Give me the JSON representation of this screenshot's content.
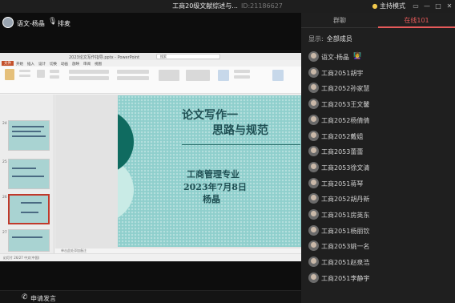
{
  "window": {
    "title": "工商20级文献综述与...",
    "room_id": "ID:21186627",
    "mode_label": "主持模式"
  },
  "stage": {
    "host_name": "语文-杨晶",
    "pin_label": "排麦"
  },
  "ppt": {
    "file_name": "2023论文写作指导.pptx - PowerPoint",
    "search_placeholder": "搜索",
    "tabs": [
      "文件",
      "开始",
      "插入",
      "设计",
      "切换",
      "动画",
      "放映",
      "审阅",
      "视图"
    ],
    "slide_numbers": [
      "24",
      "25",
      "26",
      "27"
    ],
    "notes_placeholder": "单击此处添加备注",
    "status_text": "幻灯片 26/27  中文(中国)",
    "slide": {
      "title_line1": "论文写作一",
      "title_line2": "思路与规范",
      "sub1": "工商管理专业",
      "sub2": "2023年7月8日",
      "sub3": "杨晶"
    }
  },
  "bottom": {
    "handraise_label": "申请发言"
  },
  "side": {
    "tab_chat": "群聊",
    "tab_online": "在线101",
    "filter_label": "显示:",
    "filter_value": "全部成员",
    "members": [
      {
        "name": "语文-杨晶",
        "tag": "👩‍🏫"
      },
      {
        "name": "工商2051胡宇",
        "tag": ""
      },
      {
        "name": "工商2052孙家慧",
        "tag": ""
      },
      {
        "name": "工商2053王文馨",
        "tag": ""
      },
      {
        "name": "工商2052杨倩倩",
        "tag": ""
      },
      {
        "name": "工商2052戴姐",
        "tag": ""
      },
      {
        "name": "工商2053蕾蕾",
        "tag": ""
      },
      {
        "name": "工商2053徐文清",
        "tag": ""
      },
      {
        "name": "工商2051蒋琴",
        "tag": ""
      },
      {
        "name": "工商2052胡丹新",
        "tag": ""
      },
      {
        "name": "工商2051房英东",
        "tag": ""
      },
      {
        "name": "工商2051杨丽钦",
        "tag": ""
      },
      {
        "name": "工商2053姚一名",
        "tag": ""
      },
      {
        "name": "工商2051赵泉浩",
        "tag": ""
      },
      {
        "name": "工商2051李静宇",
        "tag": ""
      }
    ]
  },
  "colors": {
    "accent": "#e65a5a",
    "slide_bg": "#8fcfcc",
    "slide_text": "#1f4f53"
  }
}
